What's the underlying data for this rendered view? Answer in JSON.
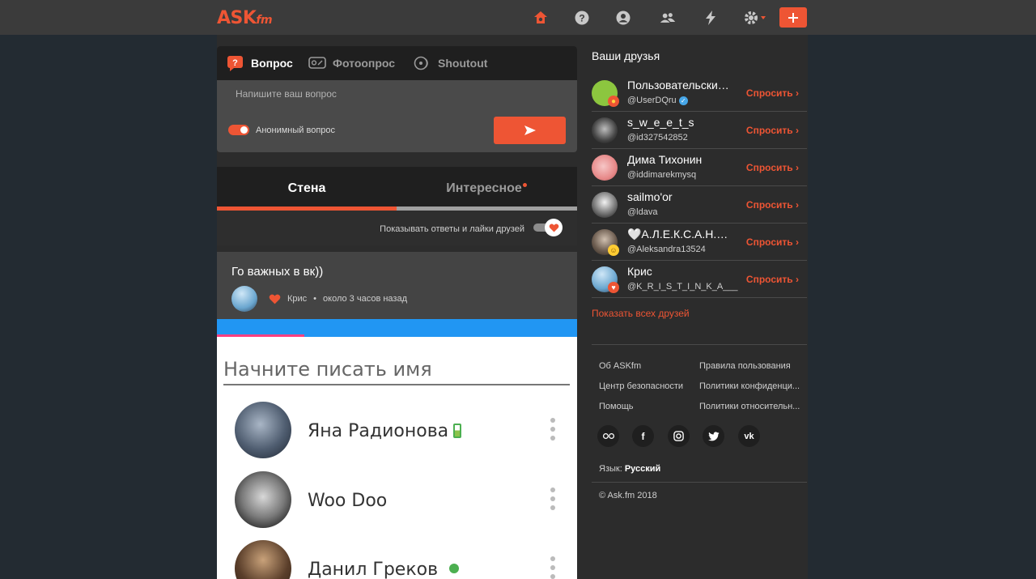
{
  "header": {
    "logo_main": "ASK",
    "logo_sub": "fm",
    "nav_icons": [
      "home-icon",
      "help-icon",
      "profile-icon",
      "friends-icon",
      "activity-icon",
      "settings-icon",
      "ask-plus-icon"
    ]
  },
  "ask_box": {
    "tabs": [
      {
        "label": "Вопрос",
        "icon": "question-icon"
      },
      {
        "label": "Фотоопрос",
        "icon": "photopoll-icon"
      },
      {
        "label": "Shoutout",
        "icon": "shoutout-icon"
      }
    ],
    "placeholder": "Напишите ваш вопрос",
    "anonymous_label": "Анонимный вопрос"
  },
  "wall": {
    "tab_wall": "Стена",
    "tab_interesting": "Интересное",
    "friends_toggle_label": "Показывать ответы и лайки друзей"
  },
  "post": {
    "question": "Го важных в вк))",
    "author": "Крис",
    "separator": "•",
    "time": "около 3 часов назад",
    "screenshot": {
      "search_placeholder": "Начните писать имя",
      "contacts": [
        {
          "name": "Яна Радионова",
          "status": "battery"
        },
        {
          "name": "Woo Doo",
          "status": ""
        },
        {
          "name": "Данил Греков",
          "status": "online"
        }
      ]
    }
  },
  "friends": {
    "title": "Ваши друзья",
    "ask_label": "Спросить",
    "items": [
      {
        "name": "Пользовательские ...",
        "handle": "@UserDQru",
        "verified": true
      },
      {
        "name": "s_w_e_e_t_s",
        "handle": "@id327542852",
        "verified": false
      },
      {
        "name": "Дима Тихонин",
        "handle": "@iddimarekmysq",
        "verified": false
      },
      {
        "name": "sailmo'or",
        "handle": "@ldava",
        "verified": false
      },
      {
        "name": "🤍А.Л.Е.К.С.А.Н.Д.Р....",
        "handle": "@Aleksandra13524",
        "verified": false
      },
      {
        "name": "Крис",
        "handle": "@K_R_I_S_T_I_N_K_A___",
        "verified": false
      }
    ],
    "show_all": "Показать всех друзей"
  },
  "footer": {
    "links_left": [
      "Об ASKfm",
      "Центр безопасности",
      "Помощь"
    ],
    "links_right": [
      "Правила пользования",
      "Политики конфиденци...",
      "Политики относительн..."
    ],
    "socials": [
      "askfm-icon",
      "facebook-icon",
      "instagram-icon",
      "twitter-icon",
      "vk-icon"
    ],
    "language_label": "Язык:",
    "language_value": "Русский",
    "copyright": "© Ask.fm 2018"
  },
  "colors": {
    "accent": "#ee5534",
    "bg": "#232b32",
    "panel": "#2c2c2c"
  }
}
